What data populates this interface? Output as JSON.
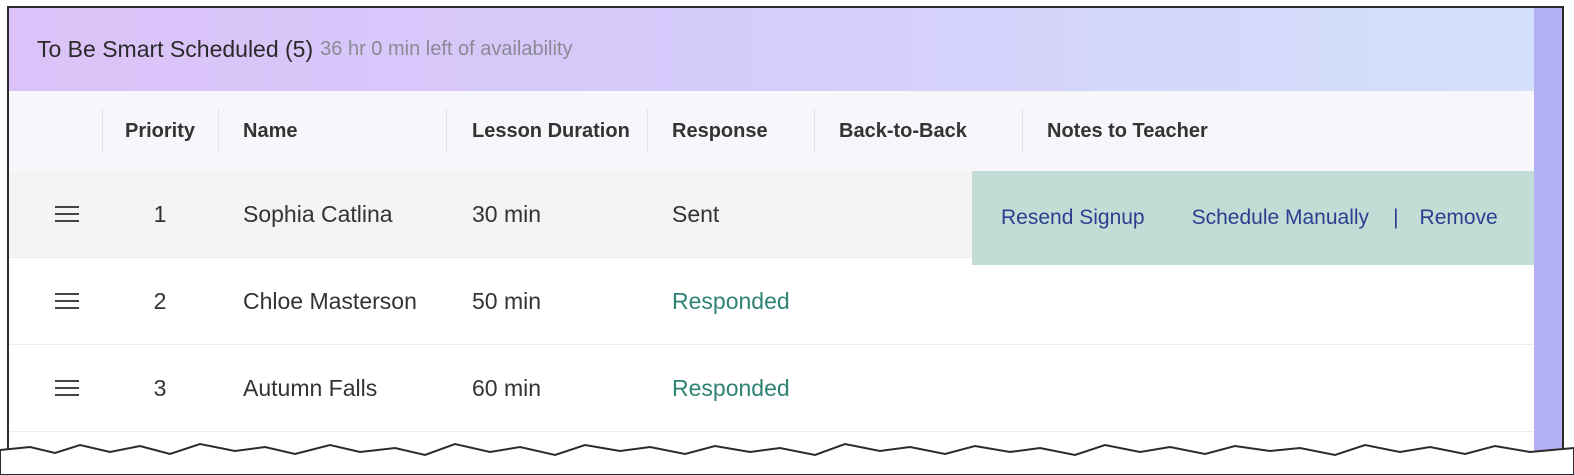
{
  "header": {
    "title": "To Be Smart Scheduled (5)",
    "subtitle": "36 hr 0 min left of availability"
  },
  "columns": [
    "Priority",
    "Name",
    "Lesson Duration",
    "Response",
    "Back-to-Back",
    "Notes to Teacher"
  ],
  "rows": [
    {
      "priority": "1",
      "name": "Sophia Catlina",
      "duration": "30 min",
      "response": "Sent"
    },
    {
      "priority": "2",
      "name": "Chloe Masterson",
      "duration": "50 min",
      "response": "Responded"
    },
    {
      "priority": "3",
      "name": "Autumn Falls",
      "duration": "60 min",
      "response": "Responded"
    }
  ],
  "row_actions": {
    "resend": "Resend Signup",
    "schedule": "Schedule Manually",
    "separator": "|",
    "remove": "Remove"
  },
  "colors": {
    "responded": "#2f8374",
    "action_link": "#2a3f8f",
    "action_bg": "#c3dcd6"
  }
}
